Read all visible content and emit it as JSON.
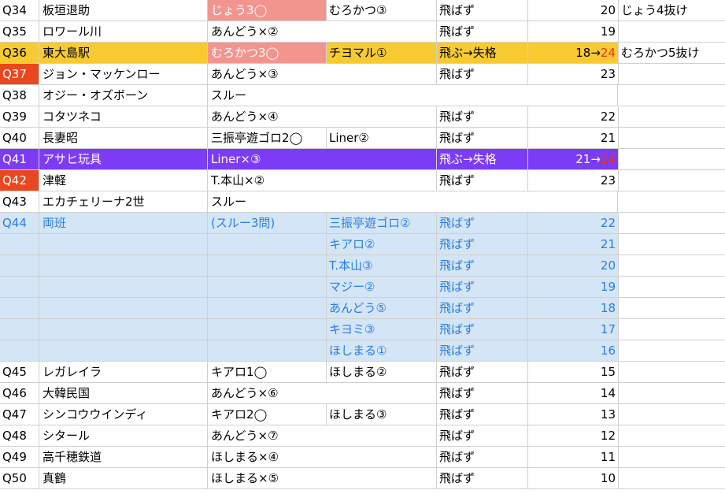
{
  "rows": [
    {
      "q": "Q34",
      "name": "板垣退助",
      "a": "じょう3◯",
      "b": "むろかつ③",
      "res": "飛ばず",
      "score": "20",
      "note": "じょう4抜け"
    },
    {
      "q": "Q35",
      "name": "ロワール川",
      "a": "あんどう×②",
      "b": "",
      "res": "飛ばず",
      "score": "19",
      "note": ""
    },
    {
      "q": "Q36",
      "name": "東大島駅",
      "a": "むろかつ3◯",
      "b": "チヨマル①",
      "res": "飛ぶ→失格",
      "score": "18→",
      "score_red": "24",
      "note": "むろかつ5抜け"
    },
    {
      "q": "Q37",
      "name": "ジョン・マッケンロー",
      "a": "あんどう×③",
      "b": "",
      "res": "飛ばず",
      "score": "23",
      "note": ""
    },
    {
      "q": "Q38",
      "name": "オジー・オズボーン",
      "a": "スルー",
      "b": "",
      "res": "",
      "score": "",
      "note": ""
    },
    {
      "q": "Q39",
      "name": "コタツネコ",
      "a": "あんどう×④",
      "b": "",
      "res": "飛ばず",
      "score": "22",
      "note": ""
    },
    {
      "q": "Q40",
      "name": "長妻昭",
      "a": "三振亭遊ゴロ2◯",
      "b": "Liner②",
      "res": "飛ばず",
      "score": "21",
      "note": ""
    },
    {
      "q": "Q41",
      "name": "アサヒ玩具",
      "a": "Liner×③",
      "b": "",
      "res": "飛ぶ→失格",
      "score": "21→",
      "score_red": "24",
      "note": ""
    },
    {
      "q": "Q42",
      "name": "津軽",
      "a": "T.本山×②",
      "b": "",
      "res": "飛ばず",
      "score": "23",
      "note": ""
    },
    {
      "q": "Q43",
      "name": "エカチェリーナ2世",
      "a": "スルー",
      "b": "",
      "res": "",
      "score": "",
      "note": ""
    },
    {
      "q": "Q44",
      "name": "両班",
      "a": "(スルー3問)",
      "b": "三振亭遊ゴロ②",
      "res": "飛ばず",
      "score": "22",
      "note": ""
    },
    {
      "q": "",
      "name": "",
      "a": "",
      "b": "キアロ②",
      "res": "飛ばず",
      "score": "21",
      "note": ""
    },
    {
      "q": "",
      "name": "",
      "a": "",
      "b": "T.本山③",
      "res": "飛ばず",
      "score": "20",
      "note": ""
    },
    {
      "q": "",
      "name": "",
      "a": "",
      "b": "マジー②",
      "res": "飛ばず",
      "score": "19",
      "note": ""
    },
    {
      "q": "",
      "name": "",
      "a": "",
      "b": "あんどう⑤",
      "res": "飛ばず",
      "score": "18",
      "note": ""
    },
    {
      "q": "",
      "name": "",
      "a": "",
      "b": "キヨミ③",
      "res": "飛ばず",
      "score": "17",
      "note": ""
    },
    {
      "q": "",
      "name": "",
      "a": "",
      "b": "ほしまる①",
      "res": "飛ばず",
      "score": "16",
      "note": ""
    },
    {
      "q": "Q45",
      "name": "レガレイラ",
      "a": "キアロ1◯",
      "b": "ほしまる②",
      "res": "飛ばず",
      "score": "15",
      "note": ""
    },
    {
      "q": "Q46",
      "name": "大韓民国",
      "a": "あんどう×⑥",
      "b": "",
      "res": "飛ばず",
      "score": "14",
      "note": ""
    },
    {
      "q": "Q47",
      "name": "シンコウウインディ",
      "a": "キアロ2◯",
      "b": "ほしまる③",
      "res": "飛ばず",
      "score": "13",
      "note": ""
    },
    {
      "q": "Q48",
      "name": "シタール",
      "a": "あんどう×⑦",
      "b": "",
      "res": "飛ばず",
      "score": "12",
      "note": ""
    },
    {
      "q": "Q49",
      "name": "高千穂鉄道",
      "a": "ほしまる×④",
      "b": "",
      "res": "飛ばず",
      "score": "11",
      "note": ""
    },
    {
      "q": "Q50",
      "name": "真鶴",
      "a": "ほしまる×⑤",
      "b": "",
      "res": "飛ばず",
      "score": "10",
      "note": ""
    }
  ],
  "colors": {
    "yellow_row": "#f7ca32",
    "purple_row": "#7c3bf5",
    "blue_row": "#d4e5f5",
    "blue_text": "#2b7de0",
    "pink_cell": "#f3958f",
    "red_label": "#e8471f",
    "red_text": "#e8361a",
    "grid": "#d0d0d0"
  }
}
